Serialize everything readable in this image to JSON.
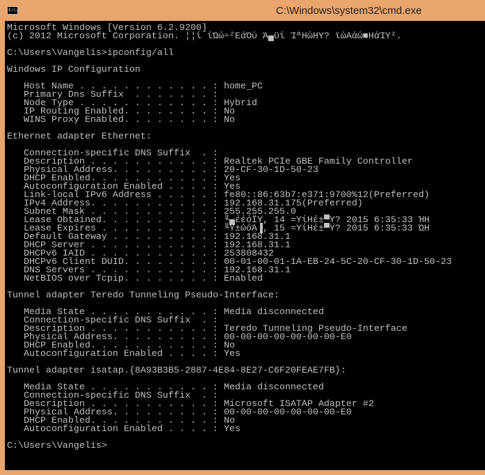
{
  "window": {
    "title": "C:\\Windows\\system32\\cmd.exe",
    "icon_label": "C:\\."
  },
  "console": {
    "lines": [
      "Microsoft Windows [Version 6.2.9200]",
      "(c) 2012 Microsoft Corporation. ¦¦ί ίΏώ÷²ΕάΌύ Ά▄ϋί ΊªΗώΗΥ? ϊώΑάώ■ΗάΊΥ².",
      "",
      "C:\\Users\\Vangelis>ipconfig/all",
      "",
      "Windows IP Configuration",
      "",
      "   Host Name . . . . . . . . . . . . : home_PC",
      "   Primary Dns Suffix  . . . . . . . :",
      "   Node Type . . . . . . . . . . . . : Hybrid",
      "   IP Routing Enabled. . . . . . . . : No",
      "   WINS Proxy Enabled. . . . . . . . : No",
      "",
      "Ethernet adapter Ethernet:",
      "",
      "   Connection-specific DNS Suffix  . :",
      "   Description . . . . . . . . . . . : Realtek PCIe GBE Family Controller",
      "   Physical Address. . . . . . . . . : 20-CF-30-1D-50-23",
      "   DHCP Enabled. . . . . . . . . . . : Yes",
      "   Autoconfiguration Enabled . . . . : Yes",
      "   Link-local IPv6 Address . . . . . : fe80::86:63b7:e371:9700%12(Preferred)",
      "   IPv4 Address. . . . . . . . . . . : 192.168.31.175(Preferred)",
      "   Subnet Mask . . . . . . . . . . . : 255.255.255.0",
      "   Lease Obtained. . . . . . . . . . : ╙▄έέόΪΥ, 14 =ΥίΗέ±▀Υ? 2015 6:35:33 ΉΗ",
      "   Lease Expires . . . . . . . . . . : ╙Υ±ώόΆ▐, 15 =ΥίΗέ±▀Υ? 2015 6:35:33 ΏΗ",
      "   Default Gateway . . . . . . . . . : 192.168.31.1",
      "   DHCP Server . . . . . . . . . . . : 192.168.31.1",
      "   DHCPv6 IAID . . . . . . . . . . . : 253808432",
      "   DHCPv6 Client DUID. . . . . . . . : 00-01-00-01-1A-EB-24-5C-20-CF-30-1D-50-23",
      "   DNS Servers . . . . . . . . . . . : 192.168.31.1",
      "   NetBIOS over Tcpip. . . . . . . . : Enabled",
      "",
      "Tunnel adapter Teredo Tunneling Pseudo-Interface:",
      "",
      "   Media State . . . . . . . . . . . : Media disconnected",
      "   Connection-specific DNS Suffix  . :",
      "   Description . . . . . . . . . . . : Teredo Tunneling Pseudo-Interface",
      "   Physical Address. . . . . . . . . : 00-00-00-00-00-00-00-E0",
      "   DHCP Enabled. . . . . . . . . . . : No",
      "   Autoconfiguration Enabled . . . . : Yes",
      "",
      "Tunnel adapter isatap.{8A93B3B5-2887-4E84-8E27-C6F20FEAE7FB}:",
      "",
      "   Media State . . . . . . . . . . . : Media disconnected",
      "   Connection-specific DNS Suffix  . :",
      "   Description . . . . . . . . . . . : Microsoft ISATAP Adapter #2",
      "   Physical Address. . . . . . . . . : 00-00-00-00-00-00-00-E0",
      "   DHCP Enabled. . . . . . . . . . . : No",
      "   Autoconfiguration Enabled . . . . : Yes",
      "",
      "C:\\Users\\Vangelis>"
    ]
  },
  "colors": {
    "frame": "#e9a56b",
    "console_bg": "#000000",
    "console_text": "#c0c0c0"
  }
}
